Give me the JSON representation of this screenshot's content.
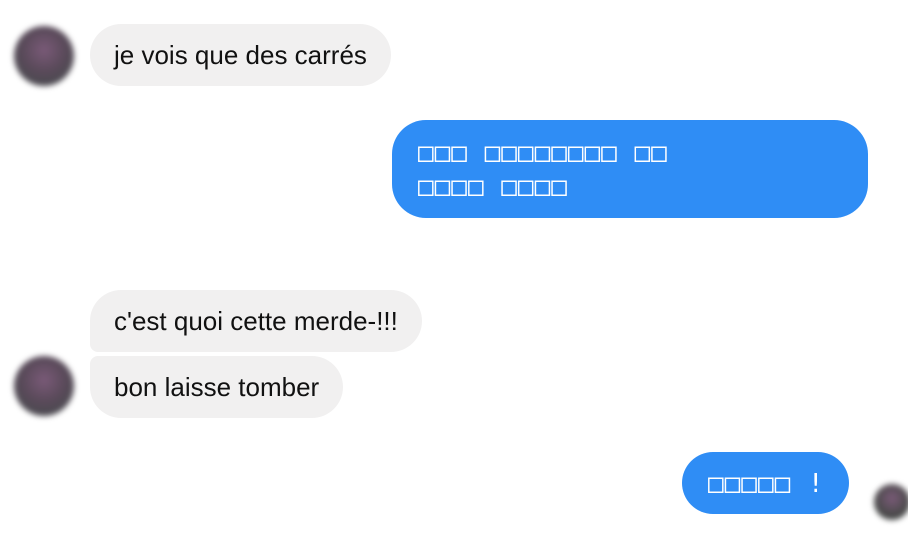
{
  "colors": {
    "incoming_bubble": "#f1f0f0",
    "outgoing_bubble": "#2f8df5",
    "incoming_text": "#111111",
    "outgoing_text": "#ffffff"
  },
  "messages": [
    {
      "direction": "incoming",
      "text": "je vois que des carrés"
    },
    {
      "direction": "outgoing",
      "lines": [
        "□□□ □□□□□□□□ □□",
        "□□□□ □□□□"
      ]
    },
    {
      "direction": "incoming",
      "text": "c'est quoi cette merde-!!!"
    },
    {
      "direction": "incoming",
      "text": "bon laisse tomber"
    },
    {
      "direction": "outgoing",
      "text": "□□□□□ !"
    }
  ],
  "avatars": [
    {
      "icon": "contact-avatar-icon"
    },
    {
      "icon": "contact-avatar-icon"
    },
    {
      "icon": "seen-avatar-icon"
    }
  ]
}
